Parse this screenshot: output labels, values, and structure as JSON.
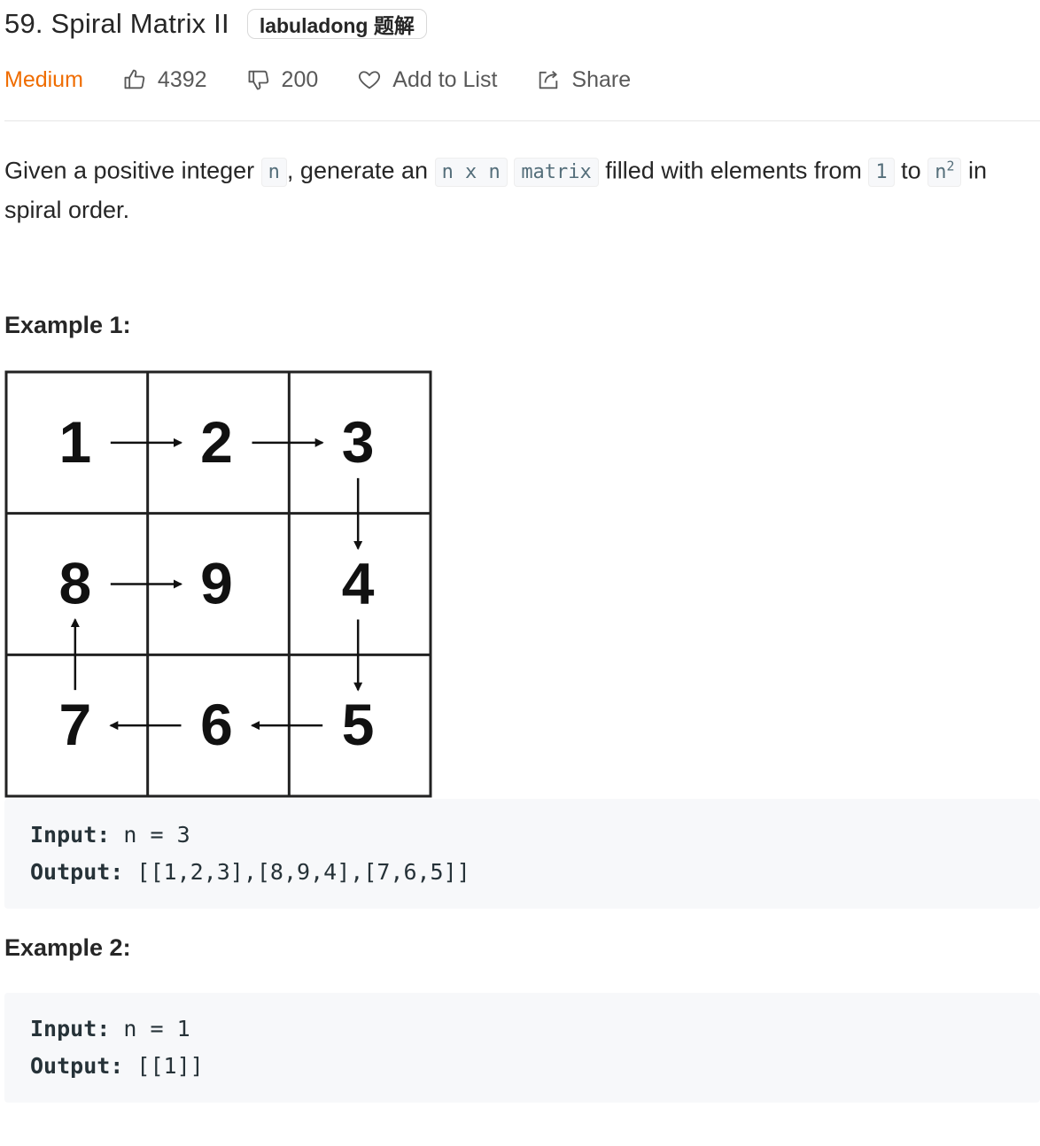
{
  "problem": {
    "title": "59. Spiral Matrix II",
    "tag": "labuladong 题解",
    "difficulty": "Medium",
    "likes": "4392",
    "dislikes": "200",
    "add_to_list": "Add to List",
    "share": "Share"
  },
  "description": {
    "p1": "Given a positive integer ",
    "c1": "n",
    "p2": ", generate an ",
    "c2": "n x n",
    "p3": " ",
    "c3": "matrix",
    "p4": " filled with elements from ",
    "c4": "1",
    "p5": " to ",
    "c5_base": "n",
    "c5_sup": "2",
    "p6": " in spiral order."
  },
  "examples": [
    {
      "title": "Example 1:",
      "matrix": [
        [
          1,
          2,
          3
        ],
        [
          8,
          9,
          4
        ],
        [
          7,
          6,
          5
        ]
      ],
      "input_label": "Input:",
      "input_value": "n = 3",
      "output_label": "Output:",
      "output_value": "[[1,2,3],[8,9,4],[7,6,5]]"
    },
    {
      "title": "Example 2:",
      "input_label": "Input:",
      "input_value": "n = 1",
      "output_label": "Output:",
      "output_value": "[[1]]"
    }
  ],
  "colors": {
    "difficulty_medium": "#ef6c00",
    "code_bg": "#f7f8fa",
    "muted_text": "#595959"
  },
  "icons": {
    "likes": "thumbs-up-icon",
    "dislikes": "thumbs-down-icon",
    "add_to_list": "heart-icon",
    "share": "share-icon"
  }
}
